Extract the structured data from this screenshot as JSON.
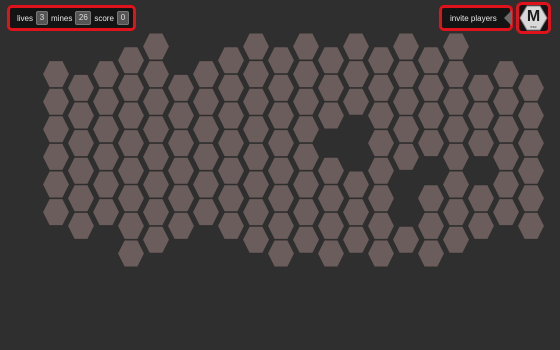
{
  "hud": {
    "lives_label": "lives",
    "lives_value": "3",
    "mines_label": "mines",
    "mines_value": "26",
    "score_label": "score",
    "score_value": "0"
  },
  "invite": {
    "label": "invite players"
  },
  "menu": {
    "letter": "M",
    "sub": "esc"
  },
  "board": {
    "rows": 8,
    "columns": 20,
    "missing_tiles": [
      "r0c5",
      "r0c6",
      "r7c5",
      "r7c6",
      "r7c7",
      "r3c11",
      "r3c12",
      "r4c12",
      "r5c14",
      "r4c15",
      "r4c17",
      "r6c14"
    ]
  },
  "colors": {
    "accent": "#e0131c",
    "tile": "#6b5d5b",
    "background": "#2f2f2f"
  }
}
